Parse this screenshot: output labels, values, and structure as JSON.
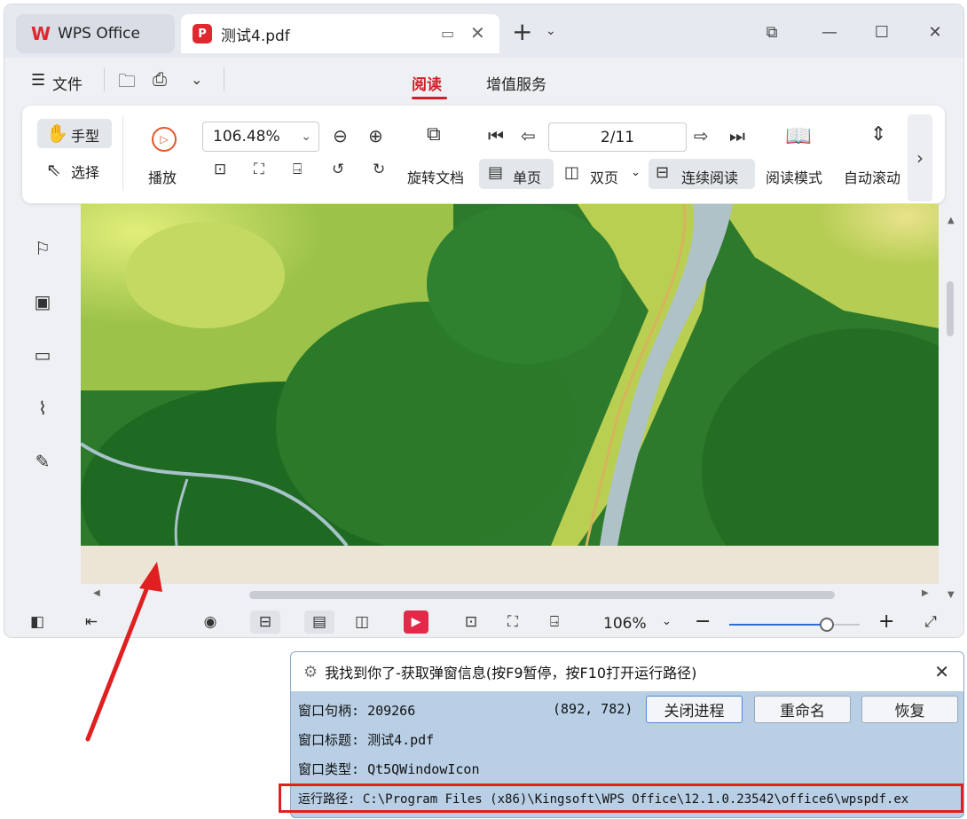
{
  "tabs": {
    "home_label": "WPS Office",
    "doc_label": "测试4.pdf"
  },
  "menubar": {
    "file_label": "文件",
    "tab_read": "阅读",
    "tab_services": "增值服务"
  },
  "ribbon": {
    "hand_label": "手型",
    "select_label": "选择",
    "play_label": "播放",
    "zoom_value": "106.48%",
    "rotate_label": "旋转文档",
    "page_value": "2/11",
    "single_label": "单页",
    "double_label": "双页",
    "continuous_label": "连续阅读",
    "read_mode_label": "阅读模式",
    "auto_scroll_label": "自动滚动"
  },
  "statusbar": {
    "zoom_value": "106%",
    "zoom_slider_fraction": 0.75
  },
  "popup": {
    "title": "我找到你了-获取弹窗信息(按F9暂停，按F10打开运行路径)",
    "handle_label": "窗口句柄:",
    "handle_value": "209266",
    "coords": "(892, 782)",
    "kill_button": "关闭进程",
    "rename_button": "重命名",
    "restore_button": "恢复",
    "title_label": "窗口标题:",
    "title_value": "测试4.pdf",
    "class_label": "窗口类型:",
    "class_value": "Qt5QWindowIcon",
    "path_label": "运行路径:",
    "path_value": "C:\\Program Files (x86)\\Kingsoft\\WPS Office\\12.1.0.23542\\office6\\wpspdf.ex"
  },
  "colors": {
    "accent_red": "#e0282e",
    "annotation_red": "#e02020",
    "popup_bg": "#b9cfe6"
  }
}
